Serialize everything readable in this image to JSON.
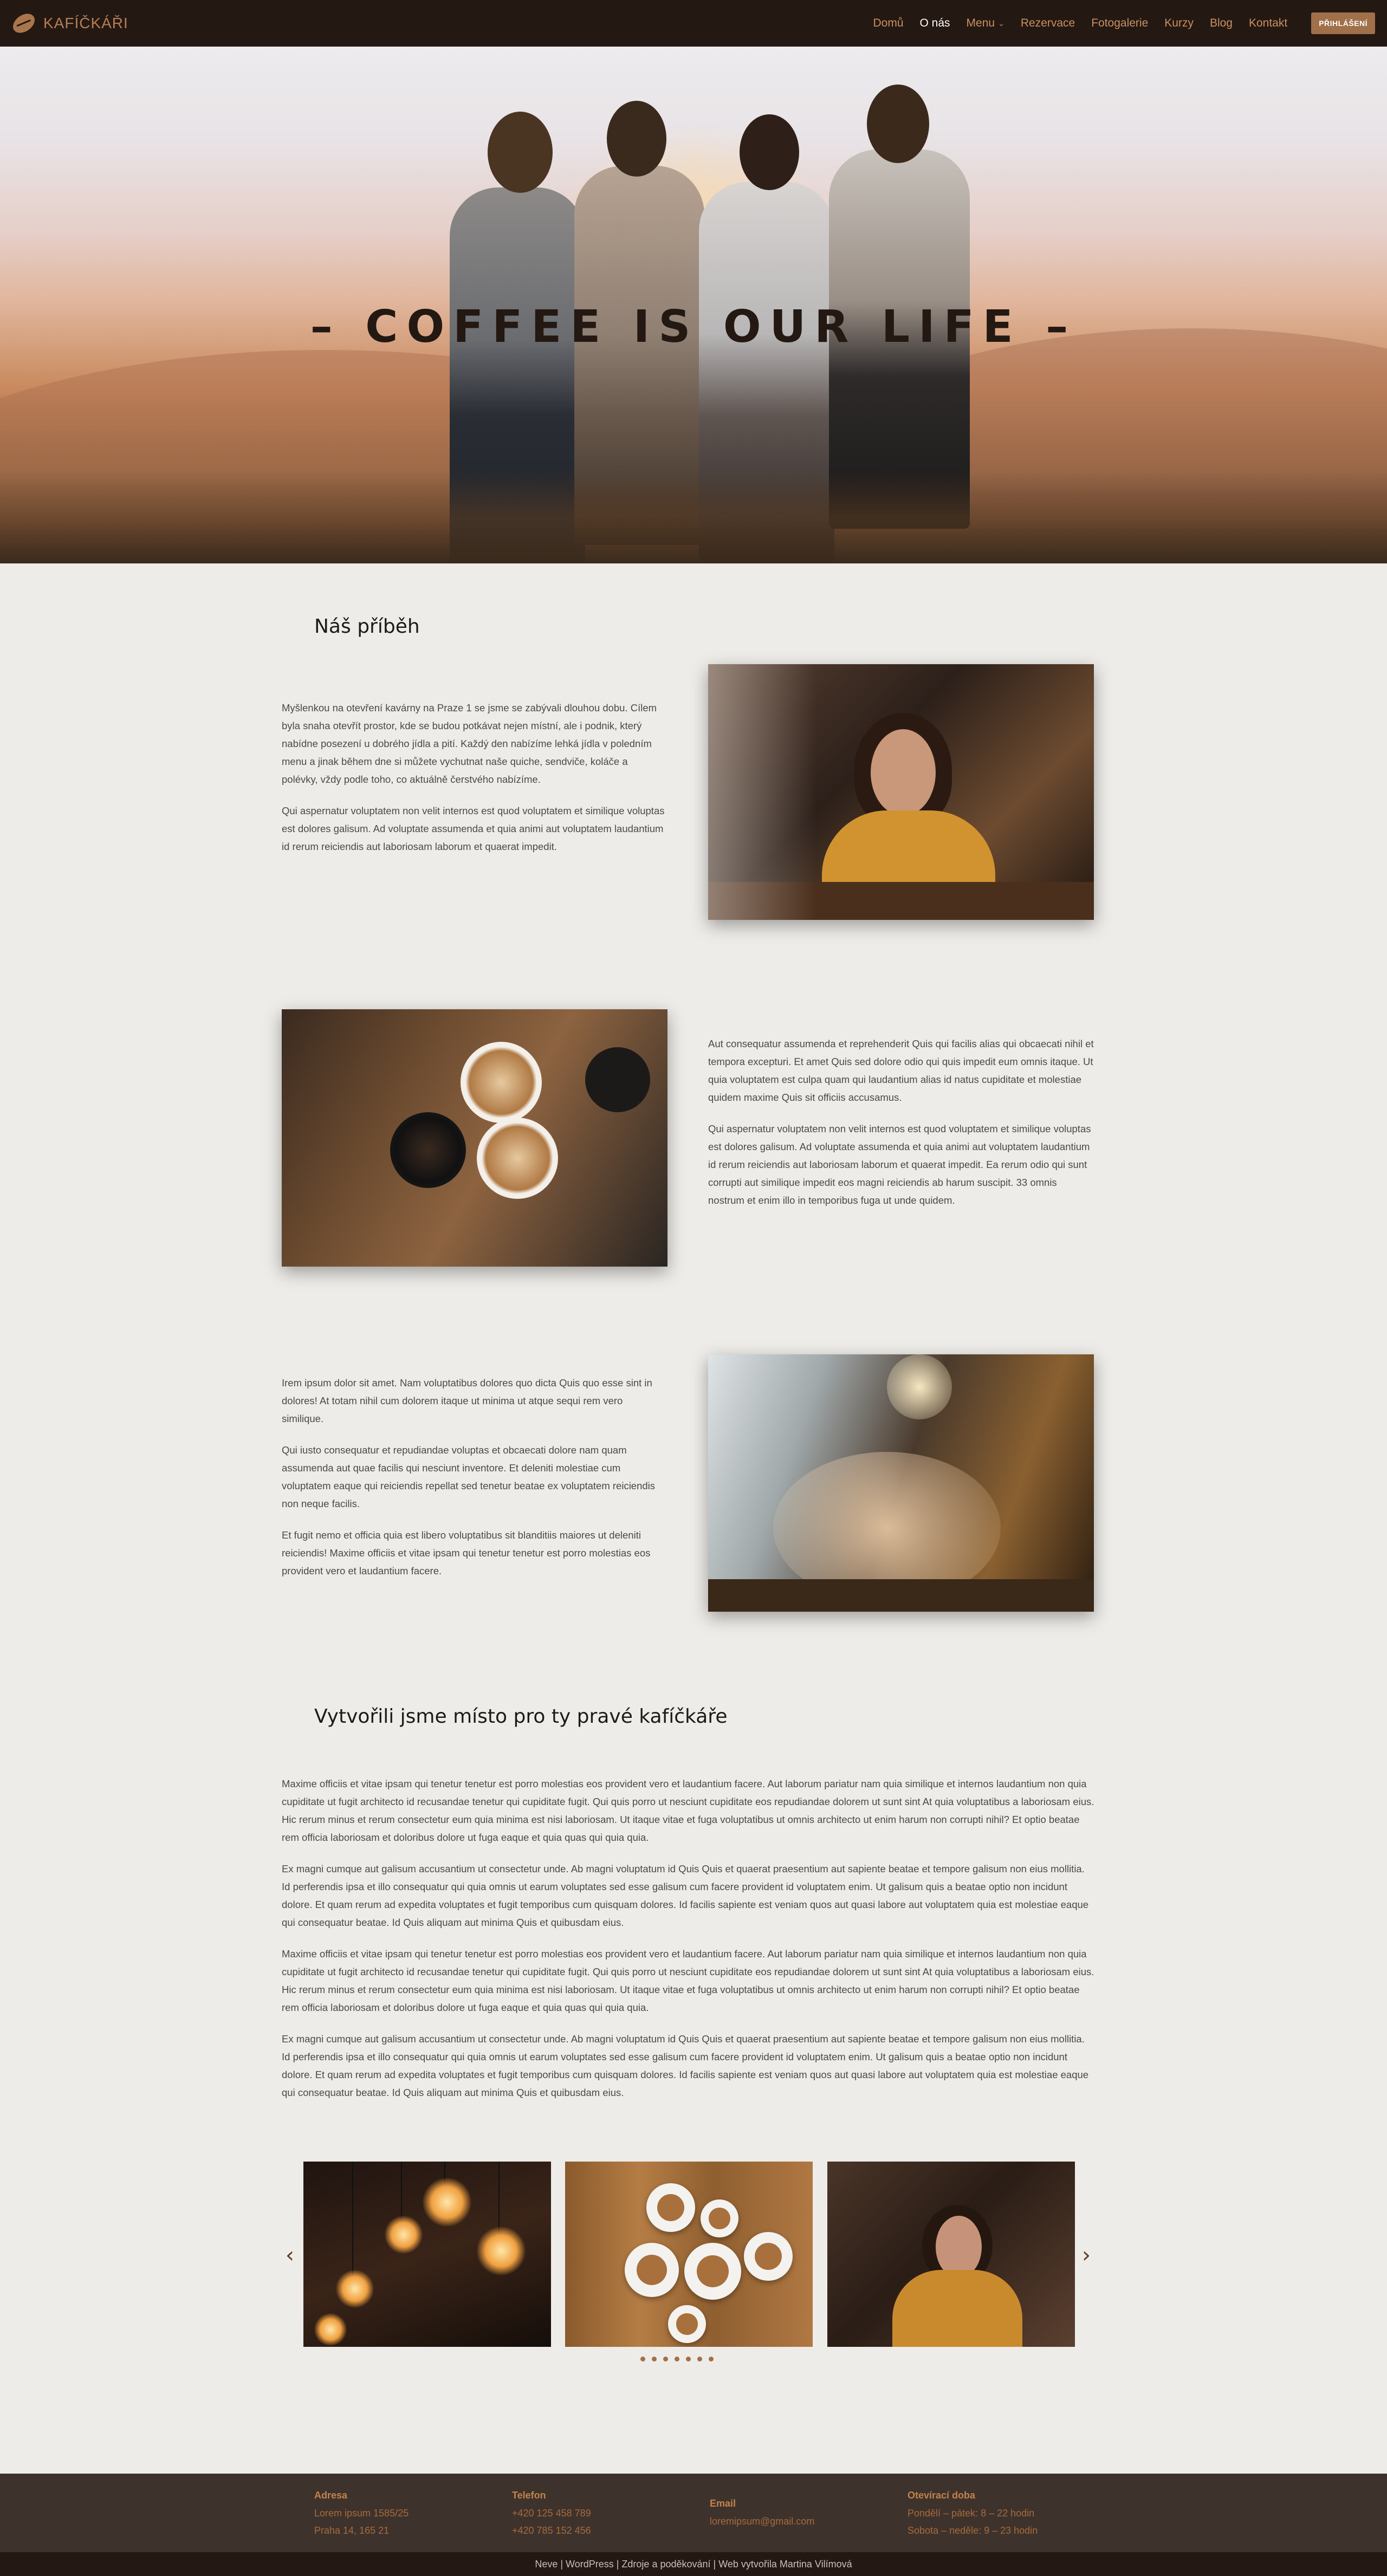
{
  "header": {
    "logo_text": "KAFÍČKÁŘI",
    "nav": [
      {
        "label": "Domů"
      },
      {
        "label": "O nás"
      },
      {
        "label": "Menu"
      },
      {
        "label": "Rezervace"
      },
      {
        "label": "Fotogalerie"
      },
      {
        "label": "Kurzy"
      },
      {
        "label": "Blog"
      },
      {
        "label": "Kontakt"
      }
    ],
    "login_label": "PŘIHLÁŠENÍ"
  },
  "hero": {
    "title": "– COFFEE IS OUR LIFE –"
  },
  "story": {
    "heading": "Náš příběh",
    "block1": [
      "Myšlenkou na otevření kavárny na Praze 1 se jsme se zabývali dlouhou dobu. Cílem byla snaha otevřít prostor, kde se budou potkávat nejen místní, ale i podnik, který nabídne posezení u dobrého jídla a pití. Každý den nabízíme lehká jídla v poledním menu a jinak během dne si můžete vychutnat naše quiche, sendviče, koláče a polévky, vždy podle toho, co aktuálně čerstvého nabízíme.",
      "Qui aspernatur voluptatem non velit internos est quod voluptatem et similique voluptas est dolores galisum. Ad voluptate assumenda et quia animi aut voluptatem laudantium id rerum reiciendis aut laboriosam laborum et quaerat impedit."
    ],
    "block2": [
      "Aut consequatur assumenda et reprehenderit Quis qui facilis alias qui obcaecati nihil et tempora excepturi. Et amet Quis sed dolore odio qui quis impedit eum omnis itaque. Ut quia voluptatem est culpa quam qui laudantium alias id natus cupiditate et molestiae quidem maxime Quis sit officiis accusamus.",
      "Qui aspernatur voluptatem non velit internos est quod voluptatem et similique voluptas est dolores galisum. Ad voluptate assumenda et quia animi aut voluptatem laudantium id rerum reiciendis aut laboriosam laborum et quaerat impedit. Ea rerum odio qui sunt corrupti aut similique impedit eos magni reiciendis ab harum suscipit. 33 omnis nostrum et enim illo in temporibus fuga ut unde quidem."
    ],
    "block3": [
      "Irem ipsum dolor sit amet. Nam voluptatibus dolores quo dicta Quis quo esse sint in dolores! At totam nihil cum dolorem itaque ut minima ut atque sequi rem vero similique.",
      "Qui iusto consequatur et repudiandae voluptas et obcaecati dolore nam quam assumenda aut quae facilis qui nesciunt inventore. Et deleniti molestiae cum voluptatem eaque qui reiciendis repellat sed tenetur beatae ex voluptatem reiciendis non neque facilis.",
      "Et fugit nemo et officia quia est libero voluptatibus sit blanditiis maiores ut deleniti reiciendis! Maxime officiis et vitae ipsam qui tenetur tenetur est porro molestias eos provident vero et laudantium facere."
    ]
  },
  "place": {
    "heading": "Vytvořili jsme místo pro ty pravé kafíčkáře",
    "paragraphs": [
      "Maxime officiis et vitae ipsam qui tenetur tenetur est porro molestias eos provident vero et laudantium facere. Aut laborum pariatur nam quia similique et internos laudantium non quia cupiditate ut fugit architecto id recusandae tenetur qui cupiditate fugit. Qui quis porro ut nesciunt cupiditate eos repudiandae dolorem ut sunt sint At quia voluptatibus a laboriosam eius. Hic rerum minus et rerum consectetur eum quia minima est nisi laboriosam. Ut itaque vitae et fuga voluptatibus ut omnis architecto ut enim harum non corrupti nihil? Et optio beatae rem officia laboriosam et doloribus dolore ut fuga eaque et quia quas qui quia quia.",
      "Ex magni cumque aut galisum accusantium ut consectetur unde. Ab magni voluptatum id Quis Quis et quaerat praesentium aut sapiente beatae et tempore galisum non eius mollitia. Id perferendis ipsa et illo consequatur qui quia omnis ut earum voluptates sed esse galisum cum facere provident id voluptatem enim. Ut galisum quis a beatae optio non incidunt dolore. Et quam rerum ad expedita voluptates et fugit temporibus cum quisquam dolores. Id facilis sapiente est veniam quos aut quasi labore aut voluptatem quia est molestiae eaque qui consequatur beatae. Id Quis aliquam aut minima Quis et quibusdam eius.",
      "Maxime officiis et vitae ipsam qui tenetur tenetur est porro molestias eos provident vero et laudantium facere. Aut laborum pariatur nam quia similique et internos laudantium non quia cupiditate ut fugit architecto id recusandae tenetur qui cupiditate fugit. Qui quis porro ut nesciunt cupiditate eos repudiandae dolorem ut sunt sint At quia voluptatibus a laboriosam eius. Hic rerum minus et rerum consectetur eum quia minima est nisi laboriosam. Ut itaque vitae et fuga voluptatibus ut omnis architecto ut enim harum non corrupti nihil? Et optio beatae rem officia laboriosam et doloribus dolore ut fuga eaque et quia quas qui quia quia.",
      "Ex magni cumque aut galisum accusantium ut consectetur unde. Ab magni voluptatum id Quis Quis et quaerat praesentium aut sapiente beatae et tempore galisum non eius mollitia. Id perferendis ipsa et illo consequatur qui quia omnis ut earum voluptates sed esse galisum cum facere provident id voluptatem enim. Ut galisum quis a beatae optio non incidunt dolore. Et quam rerum ad expedita voluptates et fugit temporibus cum quisquam dolores. Id facilis sapiente est veniam quos aut quasi labore aut voluptatem quia est molestiae eaque qui consequatur beatae. Id Quis aliquam aut minima Quis et quibusdam eius."
    ]
  },
  "carousel": {
    "prev": "‹",
    "next": "›",
    "dot_count": 7
  },
  "footer": {
    "columns": [
      {
        "title": "Adresa",
        "lines": [
          "Lorem ipsum 1585/25",
          "Praha 14, 165 21"
        ]
      },
      {
        "title": "Telefon",
        "lines": [
          "+420 125 458 789",
          "+420 785 152 456"
        ]
      },
      {
        "title": "Email",
        "lines": [
          "loremipsum@gmail.com"
        ]
      },
      {
        "title": "Otevírací doba",
        "lines": [
          "Pondělí – pátek: 8 – 22 hodin",
          "Sobota – neděle: 9 – 23 hodin"
        ]
      }
    ],
    "credits": "Neve | WordPress | Zdroje a poděkování | Web vytvořila Martina Vilímová"
  }
}
